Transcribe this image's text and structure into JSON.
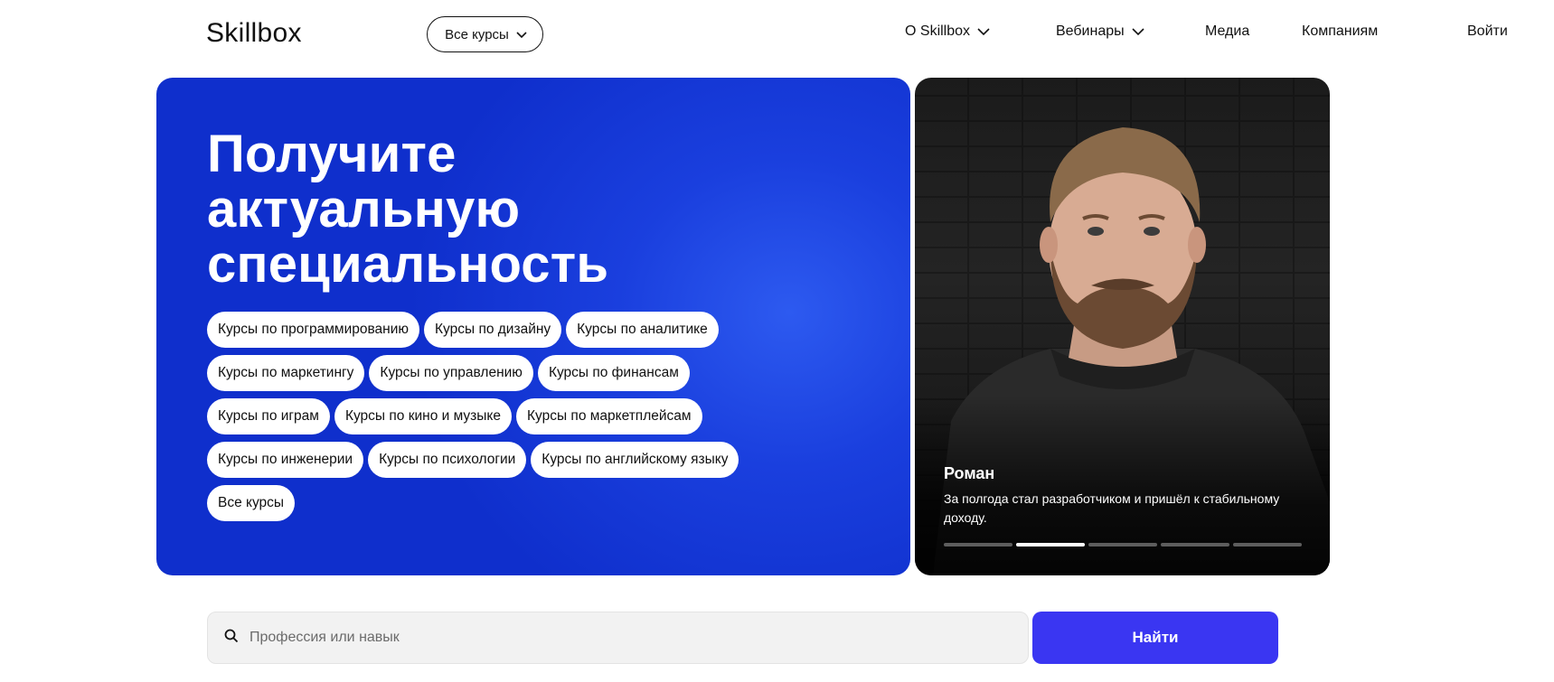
{
  "header": {
    "logo": "Skillbox",
    "all_courses_label": "Все курсы",
    "nav": [
      {
        "label": "О Skillbox",
        "has_dropdown": true
      },
      {
        "label": "Вебинары",
        "has_dropdown": true
      },
      {
        "label": "Медиа",
        "has_dropdown": false
      },
      {
        "label": "Компаниям",
        "has_dropdown": false
      }
    ],
    "login_label": "Войти"
  },
  "hero": {
    "title_line1": "Получите",
    "title_line2": "актуальную",
    "title_line3": "специальность",
    "chips": [
      "Курсы по программированию",
      "Курсы по дизайну",
      "Курсы по аналитике",
      "Курсы по маркетингу",
      "Курсы по управлению",
      "Курсы по финансам",
      "Курсы по играм",
      "Курсы по кино и музыке",
      "Курсы по маркетплейсам",
      "Курсы по инженерии",
      "Курсы по психологии",
      "Курсы по английскому языку",
      "Все курсы"
    ]
  },
  "story": {
    "name": "Роман",
    "text": "За полгода стал разработчиком и пришёл к стабильному доходу.",
    "slides_total": 5,
    "active_slide": 2
  },
  "search": {
    "placeholder": "Профессия или навык",
    "value": "",
    "button_label": "Найти"
  },
  "colors": {
    "hero_blue": "#1a3fde",
    "button_blue": "#3a36f2"
  }
}
